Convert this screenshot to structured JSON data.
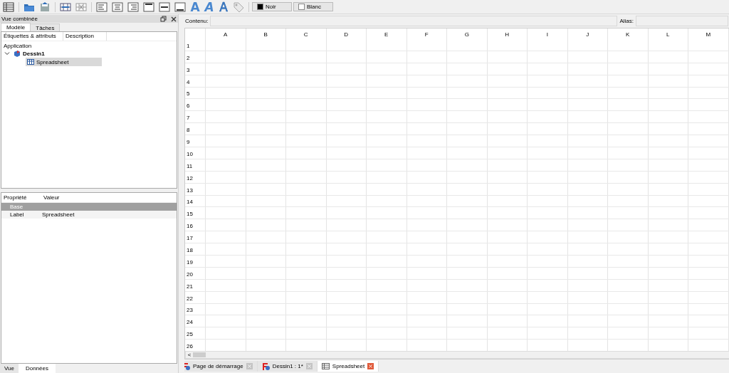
{
  "toolbar": {
    "style_buttons": [
      {
        "label": "A",
        "kind": "bold"
      },
      {
        "label": "A",
        "kind": "italic"
      },
      {
        "label": "A",
        "kind": "outline"
      }
    ],
    "color_buttons": [
      {
        "label": "Noir",
        "color": "#000000"
      },
      {
        "label": "Blanc",
        "color": "#ffffff"
      }
    ]
  },
  "combo_view": {
    "title": "Vue combinée",
    "tabs": [
      {
        "label": "Modèle",
        "selected": true
      },
      {
        "label": "Tâches",
        "selected": false
      }
    ],
    "tree_columns": [
      "Étiquettes & attributs",
      "Description"
    ],
    "tree_root": "Application",
    "tree": [
      {
        "label": "Dessin1",
        "kind": "document",
        "expanded": true,
        "selected": false,
        "children": [
          {
            "label": "Spreadsheet",
            "kind": "sheet",
            "selected": true
          }
        ]
      }
    ],
    "property_columns": [
      "Propriété",
      "Valeur"
    ],
    "properties": [
      {
        "kind": "group",
        "name": "Base"
      },
      {
        "kind": "property",
        "name": "Label",
        "value": "Spreadsheet"
      }
    ],
    "bottom_tabs": [
      {
        "label": "Vue",
        "selected": false
      },
      {
        "label": "Données",
        "selected": true
      }
    ]
  },
  "spreadsheet": {
    "content_label": "Contenu:",
    "alias_label": "Alias:",
    "columns": [
      "A",
      "B",
      "C",
      "D",
      "E",
      "F",
      "G",
      "H",
      "I",
      "J",
      "K",
      "L",
      "M"
    ],
    "rows": [
      "1",
      "2",
      "3",
      "4",
      "5",
      "6",
      "7",
      "8",
      "9",
      "10",
      "11",
      "12",
      "13",
      "14",
      "15",
      "16",
      "17",
      "18",
      "19",
      "20",
      "21",
      "22",
      "23",
      "24",
      "25",
      "26"
    ],
    "scroll_left": "<"
  },
  "document_tabs": [
    {
      "label": "Page de démarrage",
      "kind": "start",
      "selected": false
    },
    {
      "label": "Dessin1 : 1*",
      "kind": "document",
      "selected": false
    },
    {
      "label": "Spreadsheet",
      "kind": "sheet",
      "selected": true
    }
  ]
}
